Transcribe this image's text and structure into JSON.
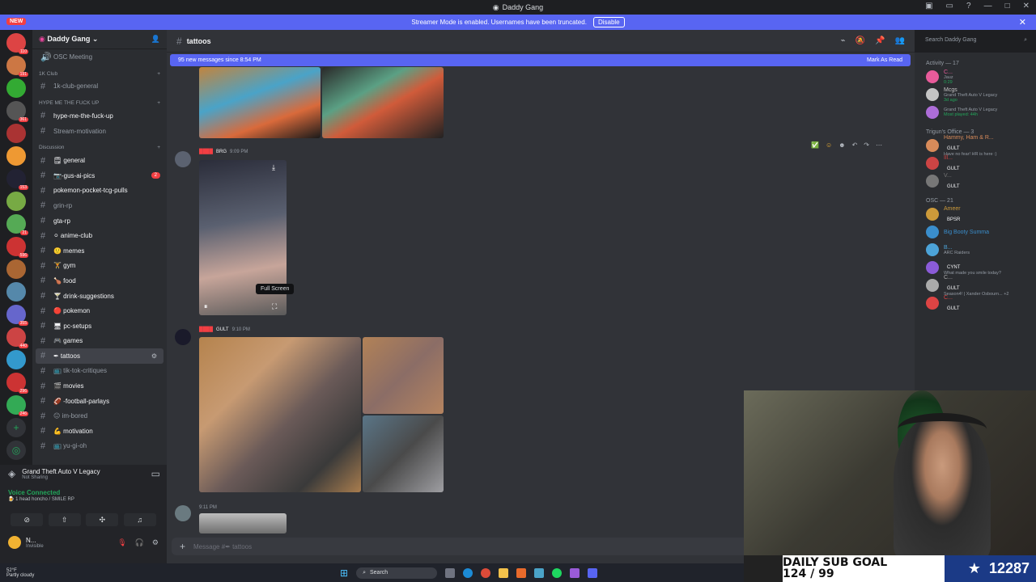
{
  "window": {
    "title": "Daddy Gang"
  },
  "banner": {
    "new_label": "NEW",
    "text": "Streamer Mode is enabled. Usernames have been truncated.",
    "disable_label": "Disable"
  },
  "guild_badges": [
    "110",
    "191",
    "",
    "361",
    "",
    "",
    "153",
    "",
    "21",
    "596",
    "",
    "",
    "355",
    "440",
    "",
    "296",
    "246"
  ],
  "sidebar": {
    "server_name": "Daddy Gang",
    "items": [
      {
        "kind": "chan",
        "label": "OSC Meeting",
        "icon": "speaker-icon"
      },
      {
        "kind": "cat",
        "label": "1K Club"
      },
      {
        "kind": "chan",
        "label": "1k-club-general"
      },
      {
        "kind": "cat",
        "label": "HYPE ME THE FUCK UP"
      },
      {
        "kind": "chan",
        "label": "hype-me-the-fuck-up",
        "bright": true
      },
      {
        "kind": "chan",
        "label": "Stream-motivation"
      },
      {
        "kind": "cat",
        "label": "Discussion"
      },
      {
        "kind": "chan",
        "label": "🗒 general",
        "bright": true
      },
      {
        "kind": "chan",
        "label": "📷-gus-ai-pics",
        "bright": true,
        "ping": "2"
      },
      {
        "kind": "chan",
        "label": "pokemon-pocket-tcg-pulls",
        "bright": true
      },
      {
        "kind": "chan",
        "label": "grin-rp"
      },
      {
        "kind": "chan",
        "label": "gta-rp",
        "bright": true
      },
      {
        "kind": "chan",
        "label": "⚪ anime-club",
        "bright": true
      },
      {
        "kind": "chan",
        "label": "🙂 memes",
        "bright": true
      },
      {
        "kind": "chan",
        "label": "🏋 gym",
        "bright": true
      },
      {
        "kind": "chan",
        "label": "🍗 food",
        "bright": true
      },
      {
        "kind": "chan",
        "label": "🍸 drink-suggestions",
        "bright": true
      },
      {
        "kind": "chan",
        "label": "🔴 pokemon",
        "bright": true
      },
      {
        "kind": "chan",
        "label": "🖥 pc-setups",
        "bright": true
      },
      {
        "kind": "chan",
        "label": "🎮 games",
        "bright": true
      },
      {
        "kind": "chan",
        "label": "✒ tattoos",
        "active": true
      },
      {
        "kind": "chan",
        "label": "📺 tik-tok-critiques"
      },
      {
        "kind": "chan",
        "label": "🎬 movies",
        "bright": true
      },
      {
        "kind": "chan",
        "label": "🏈 -football-parlays",
        "bright": true
      },
      {
        "kind": "chan",
        "label": "😐 im-bored"
      },
      {
        "kind": "chan",
        "label": "💪 motivation",
        "bright": true
      },
      {
        "kind": "chan",
        "label": "📺 yu-gi-oh"
      }
    ]
  },
  "user_panel": {
    "game": "Grand Theft Auto V Legacy",
    "game_sub": "Not Sharing",
    "voice_status": "Voice Connected",
    "voice_channel": "🍺 1 head honcho / SMILE RP",
    "me_name": "N...",
    "me_status": "Invisible"
  },
  "chat": {
    "channel": "tattoos",
    "new_messages": "95 new messages since 8:54 PM",
    "mark_read": "Mark As Read",
    "search_placeholder": "Search Daddy Gang",
    "msg1_tag": "BRG",
    "msg1_time": "9:09 PM",
    "msg2_tag": "GULT",
    "msg2_time": "9:10 PM",
    "msg3_time": "9:11 PM",
    "tooltip": "Full Screen",
    "composer_placeholder": "Message #✒ tattoos"
  },
  "members": {
    "activity_header": "Activity — 17",
    "groups": [
      {
        "header": null,
        "rows": [
          {
            "name": "C...",
            "sub": "Jauz",
            "sub2": "0:29",
            "color": "#e85b9a"
          },
          {
            "name": "Mcgs",
            "sub": "Grand Theft Auto V Legacy",
            "sub2": "3d ago",
            "color": "#c4c4c4"
          },
          {
            "name": "",
            "sub": "Grand Theft Auto V Legacy",
            "sub2": "Most played: 44h",
            "color": "#ad6dd8"
          }
        ]
      },
      {
        "header": "Trigun's Office — 3",
        "rows": [
          {
            "name": "Hammy, Ham & R...",
            "sub": "Have no fear! HR is here :)",
            "tag": "GULT",
            "color": "#d88b5a"
          },
          {
            "name": "Ill...",
            "tag": "GULT",
            "color": "#c44"
          },
          {
            "name": "V...",
            "tag": "GULT",
            "color": "#777"
          }
        ]
      },
      {
        "header": "OSC — 21",
        "rows": [
          {
            "name": "Ameer",
            "tag": "BPSR",
            "color": "#cc9a3a"
          },
          {
            "name": "Big Booty Summa",
            "color": "#3a8ecc"
          },
          {
            "name": "B...",
            "sub": "ARC Raiders",
            "color": "#4ca3d8"
          },
          {
            "name": "",
            "sub": "What made you smile today?",
            "tag": "CYNT",
            "color": "#8b5bd8"
          },
          {
            "name": "C...",
            "sub": "Season4! | Xander Osbourn... +2",
            "tag": "GULT",
            "color": "#aaa"
          },
          {
            "name": "C...",
            "tag": "GULT",
            "color": "#d44"
          }
        ]
      }
    ]
  },
  "subgoal": {
    "title": "DAILY SUB GOAL",
    "progress": "124 / 99",
    "count": "12287"
  },
  "taskbar": {
    "weather_temp": "52°F",
    "weather_desc": "Partly cloudy",
    "search": "Search"
  }
}
